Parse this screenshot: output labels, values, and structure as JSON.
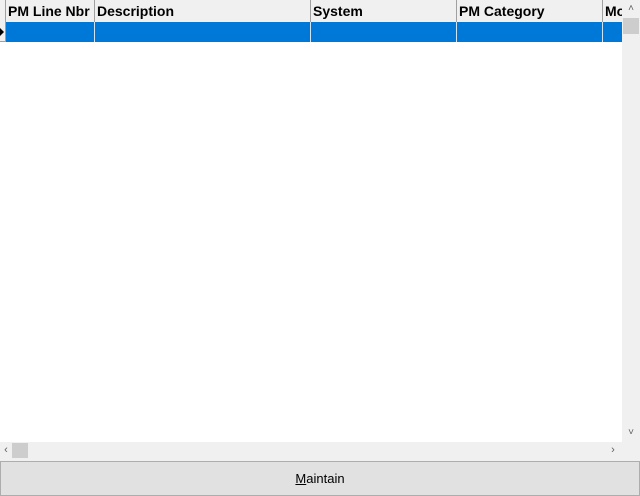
{
  "grid": {
    "columns": [
      {
        "label": "PM Line Nbr"
      },
      {
        "label": "Description"
      },
      {
        "label": "System"
      },
      {
        "label": "PM Category"
      },
      {
        "label": "Mo"
      }
    ]
  },
  "scrollbars": {
    "up_icon": "chevron-up-icon",
    "down_icon": "chevron-down-icon",
    "left_icon": "chevron-left-icon",
    "right_icon": "chevron-right-icon"
  },
  "toolbar": {
    "maintain_mnemonic": "M",
    "maintain_rest": "aintain"
  },
  "colors": {
    "selection": "#0078d7",
    "header_bg": "#f0f0f0",
    "grid_bg": "#ffffff"
  }
}
